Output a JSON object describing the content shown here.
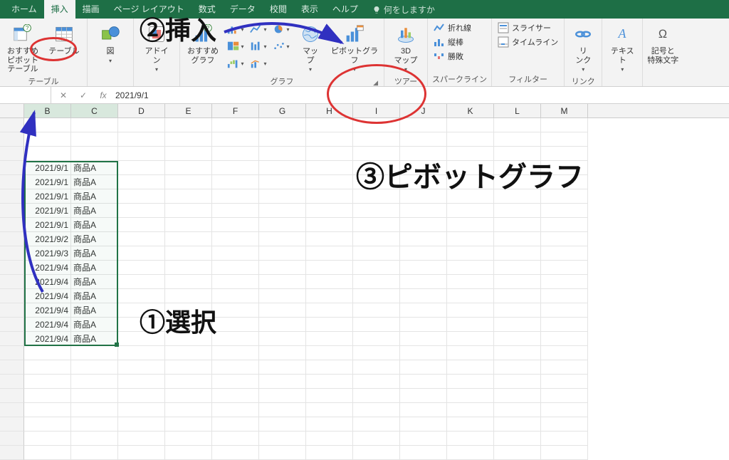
{
  "tabs": {
    "home": "ホーム",
    "insert": "挿入",
    "draw": "描画",
    "page_layout": "ページ レイアウト",
    "formulas": "数式",
    "data": "データ",
    "review": "校閲",
    "view": "表示",
    "help": "ヘルプ",
    "tell_me": "何をしますか"
  },
  "ribbon": {
    "recommended_pivot": "おすすめ\nピボットテーブル",
    "table": "テーブル",
    "tables_group": "テーブル",
    "illustrations": "図",
    "addins": "アドイ\nン",
    "recommended_charts": "おすすめ\nグラフ",
    "charts_group": "グラフ",
    "maps": "マッ\nプ",
    "pivot_chart": "ピボットグラフ",
    "map3d": "3D\nマップ",
    "tour_group": "ツアー",
    "spark_line": "折れ線",
    "spark_col": "縦棒",
    "spark_winloss": "勝敗",
    "sparklines_group": "スパークライン",
    "slicer": "スライサー",
    "timeline": "タイムライン",
    "filter_group": "フィルター",
    "link": "リ\nンク",
    "link_group": "リンク",
    "text": "テキス\nト",
    "symbols": "記号と\n特殊文字"
  },
  "formula_bar": {
    "value": "2021/9/1"
  },
  "columns": [
    "B",
    "C",
    "D",
    "E",
    "F",
    "G",
    "H",
    "I",
    "J",
    "K",
    "L",
    "M"
  ],
  "data_rows": [
    {
      "b": "2021/9/1",
      "c": "商品A"
    },
    {
      "b": "2021/9/1",
      "c": "商品A"
    },
    {
      "b": "2021/9/1",
      "c": "商品A"
    },
    {
      "b": "2021/9/1",
      "c": "商品A"
    },
    {
      "b": "2021/9/1",
      "c": "商品A"
    },
    {
      "b": "2021/9/2",
      "c": "商品A"
    },
    {
      "b": "2021/9/3",
      "c": "商品A"
    },
    {
      "b": "2021/9/4",
      "c": "商品A"
    },
    {
      "b": "2021/9/4",
      "c": "商品A"
    },
    {
      "b": "2021/9/4",
      "c": "商品A"
    },
    {
      "b": "2021/9/4",
      "c": "商品A"
    },
    {
      "b": "2021/9/4",
      "c": "商品A"
    },
    {
      "b": "2021/9/4",
      "c": "商品A"
    }
  ],
  "annotations": {
    "step1": "①選択",
    "step2": "②挿入",
    "step3": "③ピボットグラフ"
  }
}
